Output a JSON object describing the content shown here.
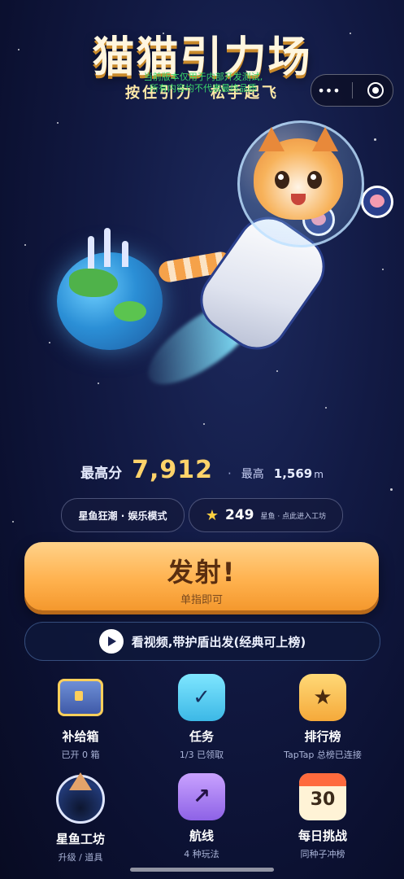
{
  "header": {
    "title": "猫猫引力场",
    "subtitle": "按住引力　松手起飞",
    "dev_notice_line1": "当前版本仅用于内部开发测试,",
    "dev_notice_line2": "所有内容均不代表最终品质",
    "capsule": {
      "more_icon": "more-dots-icon",
      "close_icon": "target-close-icon"
    }
  },
  "stats": {
    "best_score_label": "最高分",
    "best_score": "7,912",
    "best_distance_label": "最高",
    "best_distance": "1,569",
    "distance_unit": "m"
  },
  "mode_pill": {
    "label": "星鱼狂潮 · 娱乐模式"
  },
  "coins_pill": {
    "icon": "star-icon",
    "count": "249",
    "note": "星鱼 · 点此进入工坊"
  },
  "launch_button": {
    "label": "发射!",
    "sub": "单指即可"
  },
  "video_button": {
    "icon": "play-icon",
    "label": "看视频,带护盾出发(经典可上榜)"
  },
  "menu": [
    {
      "label": "补给箱",
      "sub": "已开 0 箱",
      "icon": "treasure-chest-icon"
    },
    {
      "label": "任务",
      "sub": "1/3 已领取",
      "icon": "checkmark-icon",
      "glyph": "✓"
    },
    {
      "label": "排行榜",
      "sub": "TapTap 总榜已连接",
      "icon": "star-badge-icon",
      "glyph": "★"
    },
    {
      "label": "星鱼工坊",
      "sub": "升级 / 道具",
      "icon": "cat-helmet-icon"
    },
    {
      "label": "航线",
      "sub": "4 种玩法",
      "icon": "arrow-up-right-icon",
      "glyph": "↗"
    },
    {
      "label": "每日挑战",
      "sub": "同种子冲榜",
      "icon": "calendar-icon",
      "glyph": "30"
    }
  ],
  "colors": {
    "accent_gold": "#ffd36a",
    "launch_orange": "#ffb24f",
    "background": "#121a44",
    "dev_notice_green": "#3bd96a"
  }
}
